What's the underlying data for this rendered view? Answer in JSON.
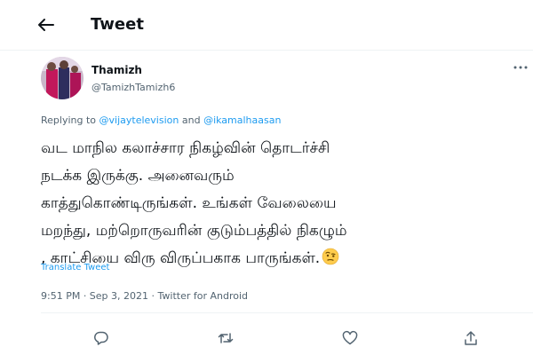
{
  "header": {
    "title": "Tweet"
  },
  "tweet": {
    "display_name": "Thamizh",
    "handle": "@TamizhTamizh6",
    "replying_prefix": "Replying to",
    "mention_1": "@vijaytelevision",
    "replying_and": "and",
    "mention_2": "@ikamalhaasan",
    "text_lines": [
      "வட மாநில கலாச்சார நிகழ்வின் தொடர்ச்சி",
      "நடக்க இருக்கு. அனைவரும்",
      "காத்துகொண்டிருங்கள். உங்கள் வேலையை",
      "மறந்து, மற்றொருவரின் குடும்பத்தில் நிகழும்",
      ", காட்சியை விரு விருப்பகாக பாருங்கள்."
    ],
    "emoji": "face-with-raised-eyebrow",
    "translate_label": "Translate Tweet",
    "meta": "9:51 PM · Sep 3, 2021 · Twitter for Android"
  },
  "icons": [
    "back-arrow",
    "more-dots",
    "reply",
    "retweet",
    "like",
    "share"
  ],
  "colors": {
    "accent": "#1d9bf0",
    "secondary_text": "#536471",
    "divider": "#eff3f4"
  }
}
